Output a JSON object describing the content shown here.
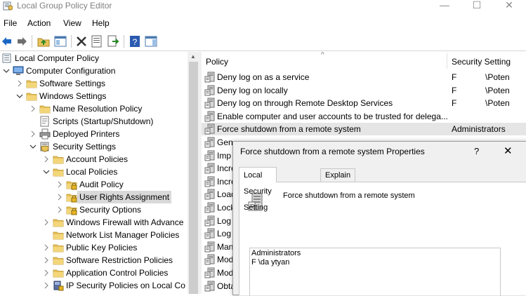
{
  "window": {
    "title": "Local Group Policy Editor",
    "minimize_glyph": "—",
    "maximize_glyph": "☐",
    "close_glyph": "✕"
  },
  "menu": {
    "file": "File",
    "action": "Action",
    "view": "View",
    "help": "Help"
  },
  "toolbar": {
    "buttons": [
      "back-icon",
      "forward-icon",
      "up-folder-icon",
      "show-hide-tree-icon",
      "delete-icon",
      "properties-icon",
      "export-list-icon",
      "help-icon",
      "show-action-pane-icon"
    ]
  },
  "tree": {
    "items": [
      {
        "label": "Local Computer Policy",
        "icon": "policy-root-icon",
        "level": 0,
        "expander": "none"
      },
      {
        "label": "Computer Configuration",
        "icon": "computer-icon",
        "level": 1,
        "expander": "expanded"
      },
      {
        "label": "Software Settings",
        "icon": "folder-icon",
        "level": 2,
        "expander": "collapsed"
      },
      {
        "label": "Windows Settings",
        "icon": "folder-icon",
        "level": 2,
        "expander": "expanded"
      },
      {
        "label": "Name Resolution Policy",
        "icon": "folder-icon",
        "level": 3,
        "expander": "collapsed"
      },
      {
        "label": "Scripts (Startup/Shutdown)",
        "icon": "scripts-icon",
        "level": 3,
        "expander": "none"
      },
      {
        "label": "Deployed Printers",
        "icon": "printer-icon",
        "level": 3,
        "expander": "collapsed"
      },
      {
        "label": "Security Settings",
        "icon": "security-settings-icon",
        "level": 3,
        "expander": "expanded"
      },
      {
        "label": "Account Policies",
        "icon": "folder-icon",
        "level": 4,
        "expander": "collapsed"
      },
      {
        "label": "Local Policies",
        "icon": "folder-icon",
        "level": 4,
        "expander": "expanded"
      },
      {
        "label": "Audit Policy",
        "icon": "lock-folder-icon",
        "level": 5,
        "expander": "collapsed"
      },
      {
        "label": "User Rights Assignment",
        "icon": "lock-folder-icon",
        "level": 5,
        "expander": "collapsed",
        "selected": true
      },
      {
        "label": "Security Options",
        "icon": "lock-folder-icon",
        "level": 5,
        "expander": "collapsed"
      },
      {
        "label": "Windows Firewall with Advance",
        "icon": "folder-icon",
        "level": 4,
        "expander": "collapsed"
      },
      {
        "label": "Network List Manager Policies",
        "icon": "folder-icon",
        "level": 4,
        "expander": "none"
      },
      {
        "label": "Public Key Policies",
        "icon": "folder-icon",
        "level": 4,
        "expander": "collapsed"
      },
      {
        "label": "Software Restriction Policies",
        "icon": "folder-icon",
        "level": 4,
        "expander": "collapsed"
      },
      {
        "label": "Application Control Policies",
        "icon": "folder-icon",
        "level": 4,
        "expander": "collapsed"
      },
      {
        "label": "IP Security Policies on Local Co",
        "icon": "ip-security-icon",
        "level": 4,
        "expander": "collapsed"
      }
    ]
  },
  "list": {
    "columns": [
      "Policy",
      "Security Setting"
    ],
    "rows": [
      {
        "name": "Deny log on as a service",
        "value": "F",
        "value2": "\\Poten"
      },
      {
        "name": "Deny log on locally",
        "value": "F",
        "value2": "\\Poten"
      },
      {
        "name": "Deny log on through Remote Desktop Services",
        "value": "F",
        "value2": "\\Poten"
      },
      {
        "name": "Enable computer and user accounts to be trusted for delega...",
        "value": "",
        "value2": ""
      },
      {
        "name": "Force shutdown from a remote system",
        "value": "Administrators",
        "value2": "",
        "selected": true
      },
      {
        "name": "Gen",
        "value": "",
        "value2": ""
      },
      {
        "name": "Imp",
        "value": "",
        "value2": ""
      },
      {
        "name": "Incre",
        "value": "",
        "value2": ""
      },
      {
        "name": "Incre",
        "value": "",
        "value2": ""
      },
      {
        "name": "Load",
        "value": "",
        "value2": ""
      },
      {
        "name": "Lock",
        "value": "",
        "value2": ""
      },
      {
        "name": "Log",
        "value": "",
        "value2": ""
      },
      {
        "name": "Log",
        "value": "",
        "value2": ""
      },
      {
        "name": "Man",
        "value": "",
        "value2": ""
      },
      {
        "name": "Mod",
        "value": "",
        "value2": ""
      },
      {
        "name": "Mod",
        "value": "",
        "value2": ""
      },
      {
        "name": "Obta",
        "value": "",
        "value2": ""
      }
    ]
  },
  "dialog": {
    "title": "Force shutdown from a remote system Properties",
    "help_glyph": "?",
    "close_glyph": "✕",
    "tabs": [
      "Local Security Setting",
      "Explain"
    ],
    "policy_name": "Force shutdown from a remote system",
    "entries": [
      "Administrators",
      "F          \\da          ytyan"
    ]
  },
  "colors": {
    "folder": "#e8c25a",
    "selection": "#d9d9d9",
    "list_selection": "#e5e5e5",
    "accent_blue": "#1a66c4"
  }
}
